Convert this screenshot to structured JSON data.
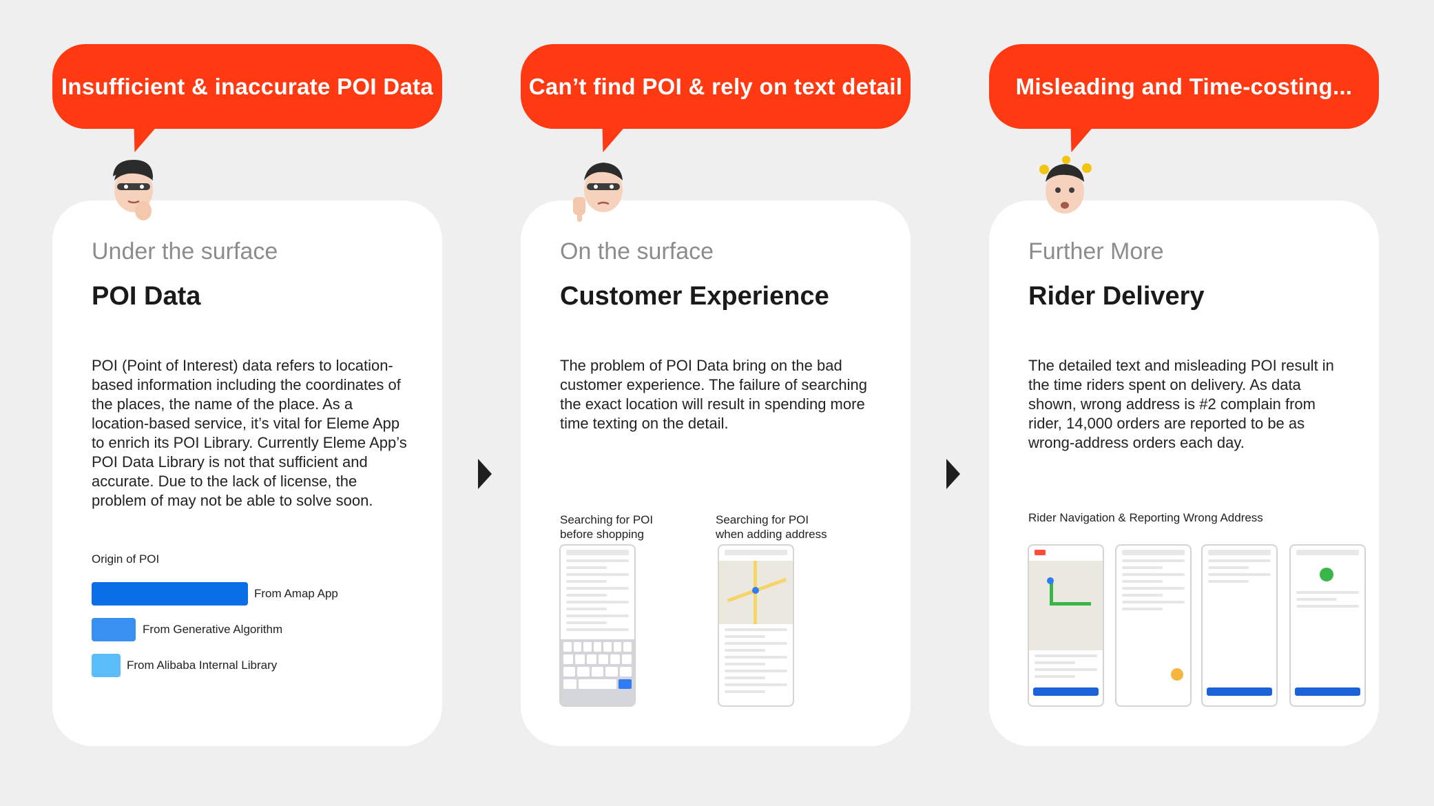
{
  "colors": {
    "accent": "#ff3a12",
    "amap": "#0a6fe6",
    "generative": "#3a90f0",
    "alibaba": "#5cbdfb"
  },
  "panels": [
    {
      "bubble": "Insufficient & inaccurate POI Data",
      "avatar": "thinking-face-avatar",
      "kicker": "Under the surface",
      "title": "POI Data",
      "description": "POI (Point of Interest) data refers to location-based information including the coordinates of the places, the name of the place. As a location-based service, it’s vital for Eleme App to enrich its POI Library. Currently Eleme App’s POI Data Library is not that sufficient and accurate. Due to the lack of license, the problem of may not be able to solve soon.",
      "legend_title": "Origin of POI",
      "legend": [
        "From Amap App",
        "From Generative Algorithm",
        "From Alibaba Internal Library"
      ]
    },
    {
      "bubble": "Can’t find POI & rely on text detail",
      "avatar": "thumbs-down-face-avatar",
      "kicker": "On the surface",
      "title": "Customer Experience",
      "description": "The problem of POI Data bring on the bad customer experience. The failure of searching the exact location will result in spending more time texting on the detail.",
      "captions": [
        "Searching for POI before shopping",
        "Searching for POI when adding address"
      ]
    },
    {
      "bubble": "Misleading and Time-costing...",
      "avatar": "dizzy-face-avatar",
      "kicker": "Further More",
      "title": "Rider Delivery",
      "description": "The detailed text and misleading POI result in the time riders spent on delivery. As data shown, wrong address is #2 complain from rider, 14,000 orders are reported to be as wrong-address orders each day.",
      "caption": "Rider Navigation & Reporting Wrong Address"
    }
  ]
}
